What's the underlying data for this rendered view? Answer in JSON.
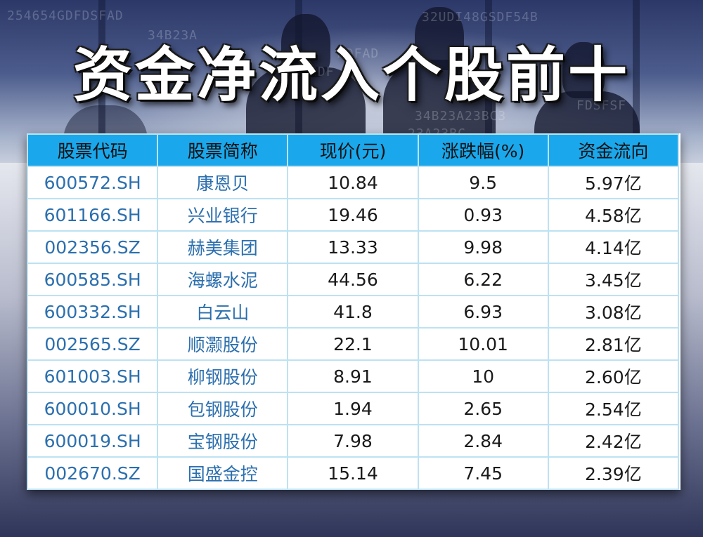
{
  "title": "资金净流入个股前十",
  "hero_decoration": [
    "254654GDFDSFAD",
    "34B23A",
    "32UDI48GSDF54B",
    "ADFAD",
    "GDF",
    "34B23A23BC3",
    "23A23BC",
    "FDSFSF"
  ],
  "table": {
    "headers": [
      "股票代码",
      "股票简称",
      "现价(元)",
      "涨跌幅(%)",
      "资金流向"
    ],
    "rows": [
      [
        "600572.SH",
        "康恩贝",
        "10.84",
        "9.5",
        "5.97亿"
      ],
      [
        "601166.SH",
        "兴业银行",
        "19.46",
        "0.93",
        "4.58亿"
      ],
      [
        "002356.SZ",
        "赫美集团",
        "13.33",
        "9.98",
        "4.14亿"
      ],
      [
        "600585.SH",
        "海螺水泥",
        "44.56",
        "6.22",
        "3.45亿"
      ],
      [
        "600332.SH",
        "白云山",
        "41.8",
        "6.93",
        "3.08亿"
      ],
      [
        "002565.SZ",
        "顺灏股份",
        "22.1",
        "10.01",
        "2.81亿"
      ],
      [
        "601003.SH",
        "柳钢股份",
        "8.91",
        "10",
        "2.60亿"
      ],
      [
        "600010.SH",
        "包钢股份",
        "1.94",
        "2.65",
        "2.54亿"
      ],
      [
        "600019.SH",
        "宝钢股份",
        "7.98",
        "2.84",
        "2.42亿"
      ],
      [
        "002670.SZ",
        "国盛金控",
        "15.14",
        "7.45",
        "2.39亿"
      ]
    ]
  }
}
